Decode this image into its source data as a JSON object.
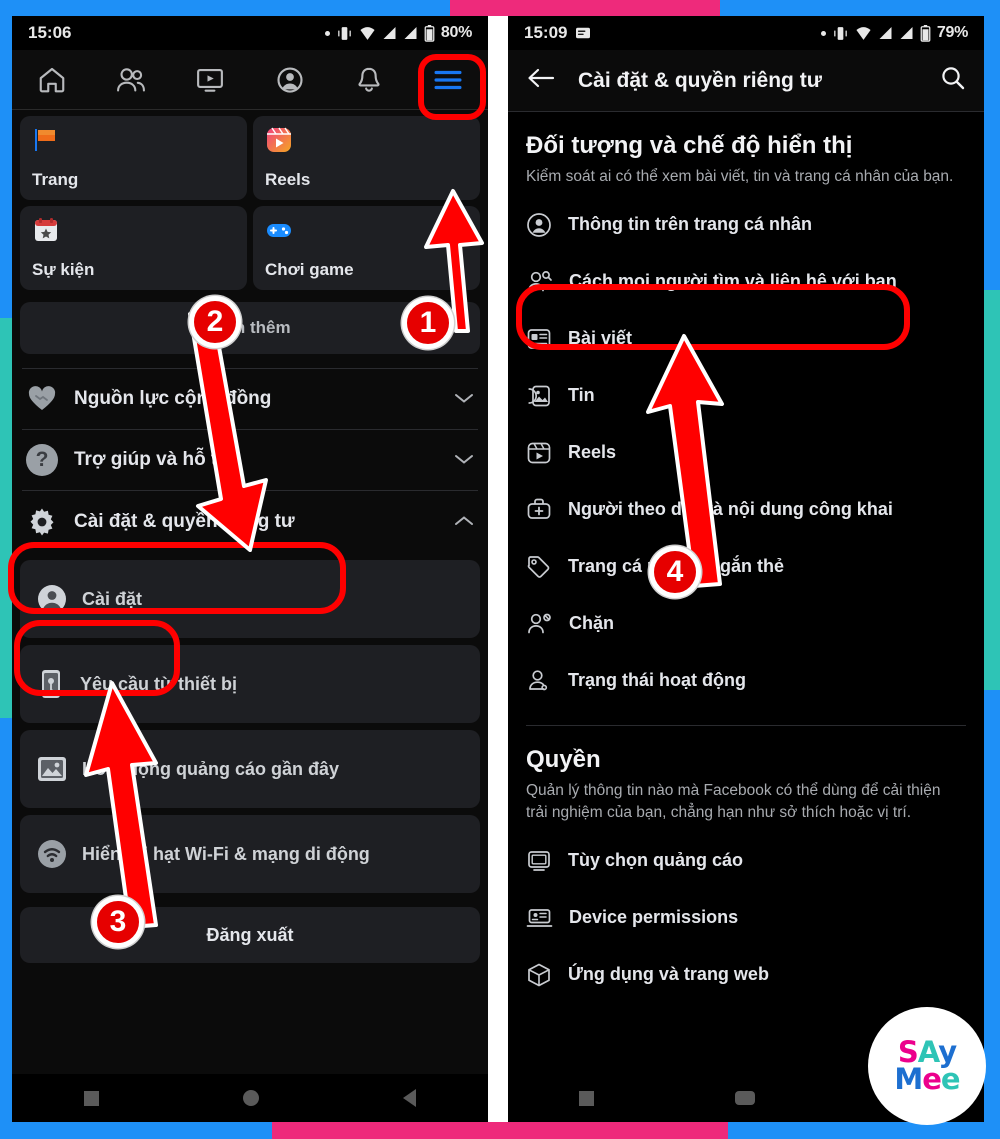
{
  "frame": {
    "blue": "#1e90f7",
    "pink": "#ee2a7b",
    "teal": "#2ec4b6"
  },
  "annotation": {
    "highlight_color": "#ff0000",
    "badge_color": "#e60000",
    "steps": [
      {
        "number": "1",
        "target": "hamburger-menu-button"
      },
      {
        "number": "2",
        "target": "settings-privacy-row"
      },
      {
        "number": "3",
        "target": "settings-card"
      },
      {
        "number": "4",
        "target": "how-people-find-you-row"
      }
    ]
  },
  "left_phone": {
    "status_bar": {
      "time": "15:06",
      "battery": "80%",
      "icons": [
        "dot",
        "vibrate-icon",
        "wifi-icon",
        "signal-icon",
        "signal-icon",
        "battery-icon"
      ]
    },
    "tab_bar": {
      "tabs": [
        {
          "name": "home-icon",
          "active": false
        },
        {
          "name": "friends-icon",
          "active": false
        },
        {
          "name": "video-icon",
          "active": false
        },
        {
          "name": "profile-icon",
          "active": false
        },
        {
          "name": "notifications-icon",
          "active": false
        },
        {
          "name": "hamburger-menu-icon",
          "active": true
        }
      ]
    },
    "shortcuts": [
      {
        "label": "Trang",
        "icon": "flag-icon"
      },
      {
        "label": "Reels",
        "icon": "reels-icon"
      },
      {
        "label": "Sự kiện",
        "icon": "calendar-star-icon"
      },
      {
        "label": "Chơi game",
        "icon": "gamepad-icon"
      }
    ],
    "see_more_label": "Xem thêm",
    "menu_rows": [
      {
        "label": "Nguồn lực cộng đồng",
        "icon": "handshake-heart-icon",
        "chevron": "down"
      },
      {
        "label": "Trợ giúp và hỗ trợ",
        "icon": "question-mark-icon",
        "chevron": "down"
      },
      {
        "label": "Cài đặt & quyền riêng tư",
        "icon": "gear-icon",
        "chevron": "up"
      }
    ],
    "sub_cards": [
      {
        "label": "Cài đặt",
        "icon": "person-circle-icon"
      },
      {
        "label": "Yêu cầu từ thiết bị",
        "icon": "device-key-icon"
      },
      {
        "label": "Hoạt động quảng cáo gần đây",
        "icon": "ad-activity-icon"
      },
      {
        "label": "Hiển thị hạt Wi-Fi & mạng di động",
        "icon": "wifi-icon"
      }
    ],
    "logout_label": "Đăng xuất"
  },
  "right_phone": {
    "status_bar": {
      "time": "15:09",
      "battery": "79%",
      "icons": [
        "notification-icon",
        "dot",
        "vibrate-icon",
        "wifi-icon",
        "signal-icon",
        "signal-icon",
        "battery-icon"
      ]
    },
    "header": {
      "back_icon": "arrow-left-icon",
      "title": "Cài đặt & quyền riêng tư",
      "search_icon": "search-icon"
    },
    "sections": [
      {
        "title": "Đối tượng và chế độ hiển thị",
        "description": "Kiểm soát ai có thể xem bài viết, tin và trang cá nhân của bạn.",
        "items": [
          {
            "label": "Thông tin trên trang cá nhân",
            "icon": "person-circle-icon"
          },
          {
            "label": "Cách mọi người tìm và liên hệ với bạn",
            "icon": "people-search-icon"
          },
          {
            "label": "Bài viết",
            "icon": "posts-icon"
          },
          {
            "label": "Tin",
            "icon": "story-icon"
          },
          {
            "label": "Reels",
            "icon": "reels-icon"
          },
          {
            "label": "Người theo dõi và nội dung công khai",
            "icon": "add-follower-icon"
          },
          {
            "label": "Trang cá nhân và gắn thẻ",
            "icon": "tag-icon"
          },
          {
            "label": "Chặn",
            "icon": "block-person-icon"
          },
          {
            "label": "Trạng thái hoạt động",
            "icon": "person-active-icon"
          }
        ]
      },
      {
        "title": "Quyền",
        "description": "Quản lý thông tin nào mà Facebook có thể dùng để cải thiện trải nghiệm của bạn, chẳng hạn như sở thích hoặc vị trí.",
        "items": [
          {
            "label": "Tùy chọn quảng cáo",
            "icon": "monitor-icon"
          },
          {
            "label": "Device permissions",
            "icon": "device-permissions-icon"
          },
          {
            "label": "Ứng dụng và trang web",
            "icon": "cube-icon"
          }
        ]
      }
    ]
  },
  "watermark": {
    "line1": "SAy",
    "line2": "Mee"
  }
}
